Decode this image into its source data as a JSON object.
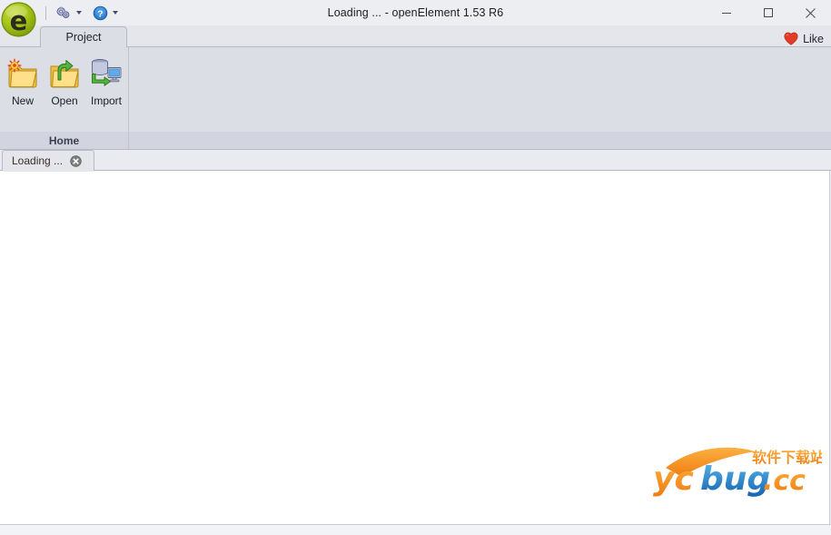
{
  "window": {
    "title": "Loading ... - openElement 1.53 R6",
    "app_name": "openElement",
    "version": "1.53 R6",
    "logo_icon": "openelement-logo-icon",
    "controls": [
      {
        "name": "minimize",
        "icon": "minimize-icon",
        "label": "—"
      },
      {
        "name": "maximize",
        "icon": "maximize-icon",
        "label": "☐"
      },
      {
        "name": "close",
        "icon": "close-icon",
        "label": "✕"
      }
    ]
  },
  "quick_access": {
    "items": [
      {
        "name": "settings",
        "icon": "gears-icon",
        "has_dropdown": true
      },
      {
        "name": "help",
        "icon": "help-question-icon",
        "has_dropdown": true
      }
    ]
  },
  "ribbon": {
    "tabs": [
      {
        "label": "Project",
        "active": true
      }
    ],
    "like_button": {
      "label": "Like",
      "icon": "heart-icon",
      "color": "#e23b26"
    },
    "groups": [
      {
        "caption": "Home",
        "buttons": [
          {
            "label": "New",
            "icon": "new-folder-icon"
          },
          {
            "label": "Open",
            "icon": "open-folder-icon"
          },
          {
            "label": "Import",
            "icon": "import-database-icon"
          }
        ]
      }
    ]
  },
  "document_tabs": [
    {
      "label": "Loading ...",
      "active": true,
      "close_icon": "close-circle-icon"
    }
  ],
  "canvas": {
    "content": ""
  },
  "watermark": {
    "brand_yc": "yc",
    "brand_bug": "bug",
    "brand_tld": ".cc",
    "chinese_text": "软件下载站",
    "colors": {
      "orange": "#f08019",
      "blue": "#1b77c8"
    }
  },
  "colors": {
    "title_bar": "#eceef2",
    "ribbon_body": "#dcdee6",
    "tab_strip": "#e4e6ec",
    "group_caption_bg": "#d2d5df",
    "canvas": "#ffffff",
    "border": "#b6bac7",
    "logo_green": "#a0c116"
  }
}
